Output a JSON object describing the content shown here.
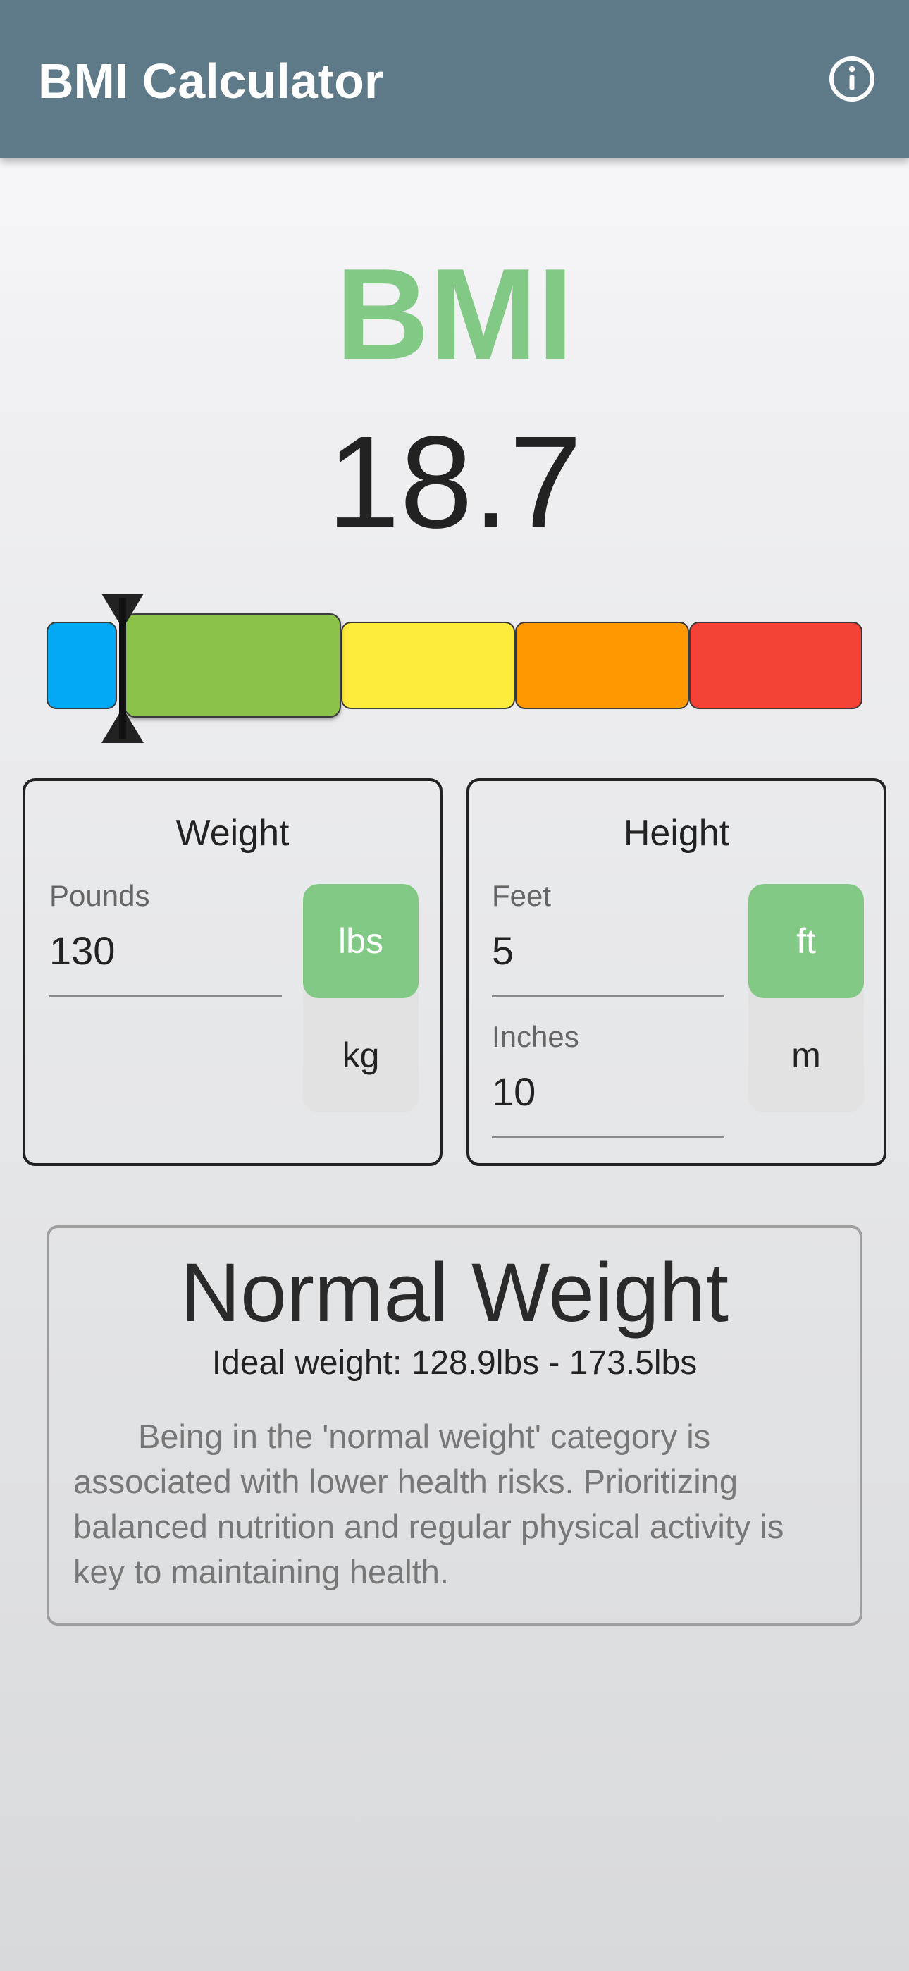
{
  "app_bar": {
    "title": "BMI Calculator",
    "info_icon": "info-icon",
    "background": "#5e7a89"
  },
  "bmi": {
    "label": "BMI",
    "value": "18.7",
    "label_color": "#82c985"
  },
  "scale": {
    "active_segment": "normal",
    "segments": [
      {
        "name": "underweight",
        "color": "#03a9f4"
      },
      {
        "name": "normal",
        "color": "#8bc34a"
      },
      {
        "name": "overweight",
        "color": "#ffeb3b"
      },
      {
        "name": "obese",
        "color": "#ff9800"
      },
      {
        "name": "extremely-obese",
        "color": "#f44336"
      }
    ],
    "marker_icon": "hourglass-marker-icon"
  },
  "weight_card": {
    "title": "Weight",
    "field_label": "Pounds",
    "field_value": "130",
    "unit_selected": "lbs",
    "unit_other": "kg"
  },
  "height_card": {
    "title": "Height",
    "feet_label": "Feet",
    "feet_value": "5",
    "inches_label": "Inches",
    "inches_value": "10",
    "unit_selected": "ft",
    "unit_other": "m"
  },
  "result": {
    "category": "Normal Weight",
    "ideal_weight": "Ideal weight: 128.9lbs - 173.5lbs",
    "description": "Being in the 'normal weight' category is associated with lower health risks. Prioritizing balanced nutrition and regular physical activity is key to maintaining health."
  }
}
